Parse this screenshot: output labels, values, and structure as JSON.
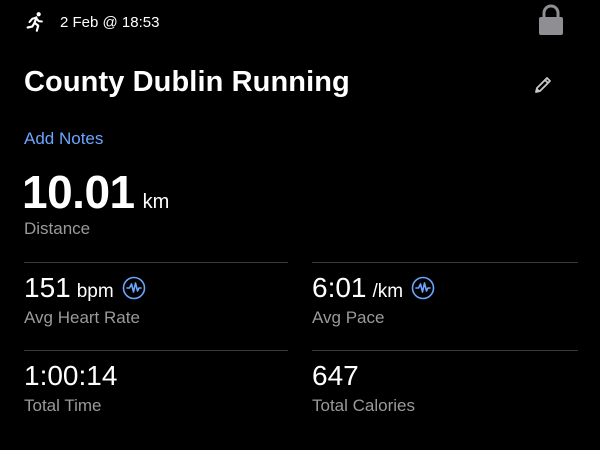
{
  "status": {
    "activity_icon": "running-person-icon",
    "date_time": "2 Feb @ 18:53",
    "lock_icon": "lock-icon"
  },
  "workout": {
    "title": "County Dublin Running",
    "edit_icon": "pencil-icon",
    "add_notes": "Add Notes",
    "distance": {
      "value": "10.01",
      "unit": "km",
      "label": "Distance"
    }
  },
  "stats": {
    "heart_rate": {
      "value": "151",
      "unit": "bpm",
      "label": "Avg Heart Rate",
      "icon": "waveform-icon"
    },
    "pace": {
      "value": "6:01",
      "unit": "/km",
      "label": "Avg Pace",
      "icon": "waveform-icon"
    },
    "total_time": {
      "value": "1:00:14",
      "label": "Total Time"
    },
    "calories": {
      "value": "647",
      "label": "Total Calories"
    }
  },
  "colors": {
    "background": "#000000",
    "accent_blue": "#6aa6ff",
    "secondary_text": "#9a9a9a",
    "divider": "#3a3a3a",
    "lock_gray": "#8e8e93"
  }
}
